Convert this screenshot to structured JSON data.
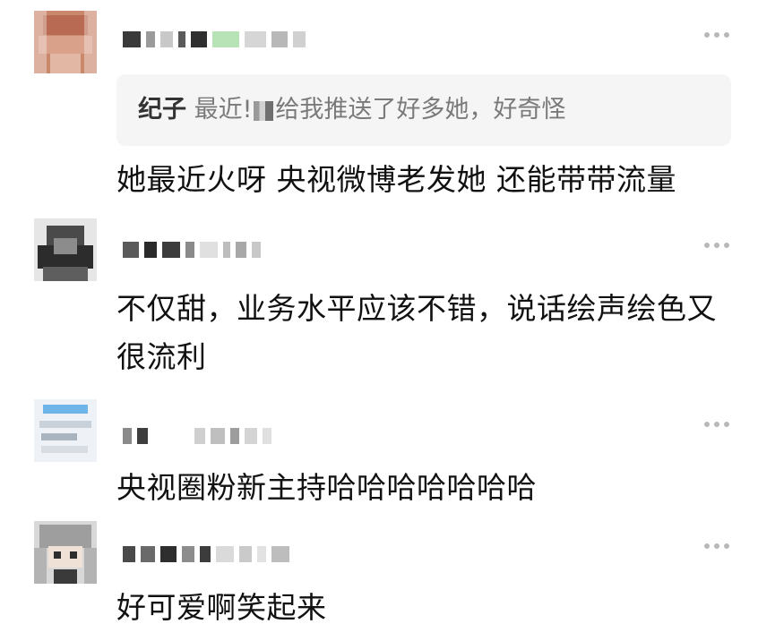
{
  "comments": [
    {
      "id": "c1",
      "quote": {
        "author": "纪子",
        "text_before": " 最近!",
        "text_after": "给我推送了好多她，好奇怪"
      },
      "text": "她最近火呀 央视微博老发她 还能带带流量"
    },
    {
      "id": "c2",
      "text": "不仅甜，业务水平应该不错，说话绘声绘色又很流利"
    },
    {
      "id": "c3",
      "text": "央视圈粉新主持哈哈哈哈哈哈哈"
    },
    {
      "id": "c4",
      "text": "好可爱啊笑起来"
    }
  ],
  "colors": {
    "quote_bg": "#f5f5f5",
    "quote_author": "#333333",
    "quote_text": "#7a7a7a",
    "more_dots": "#b8b8b8",
    "body_text": "#111111"
  },
  "icons": {
    "more": "more-horizontal-icon"
  }
}
